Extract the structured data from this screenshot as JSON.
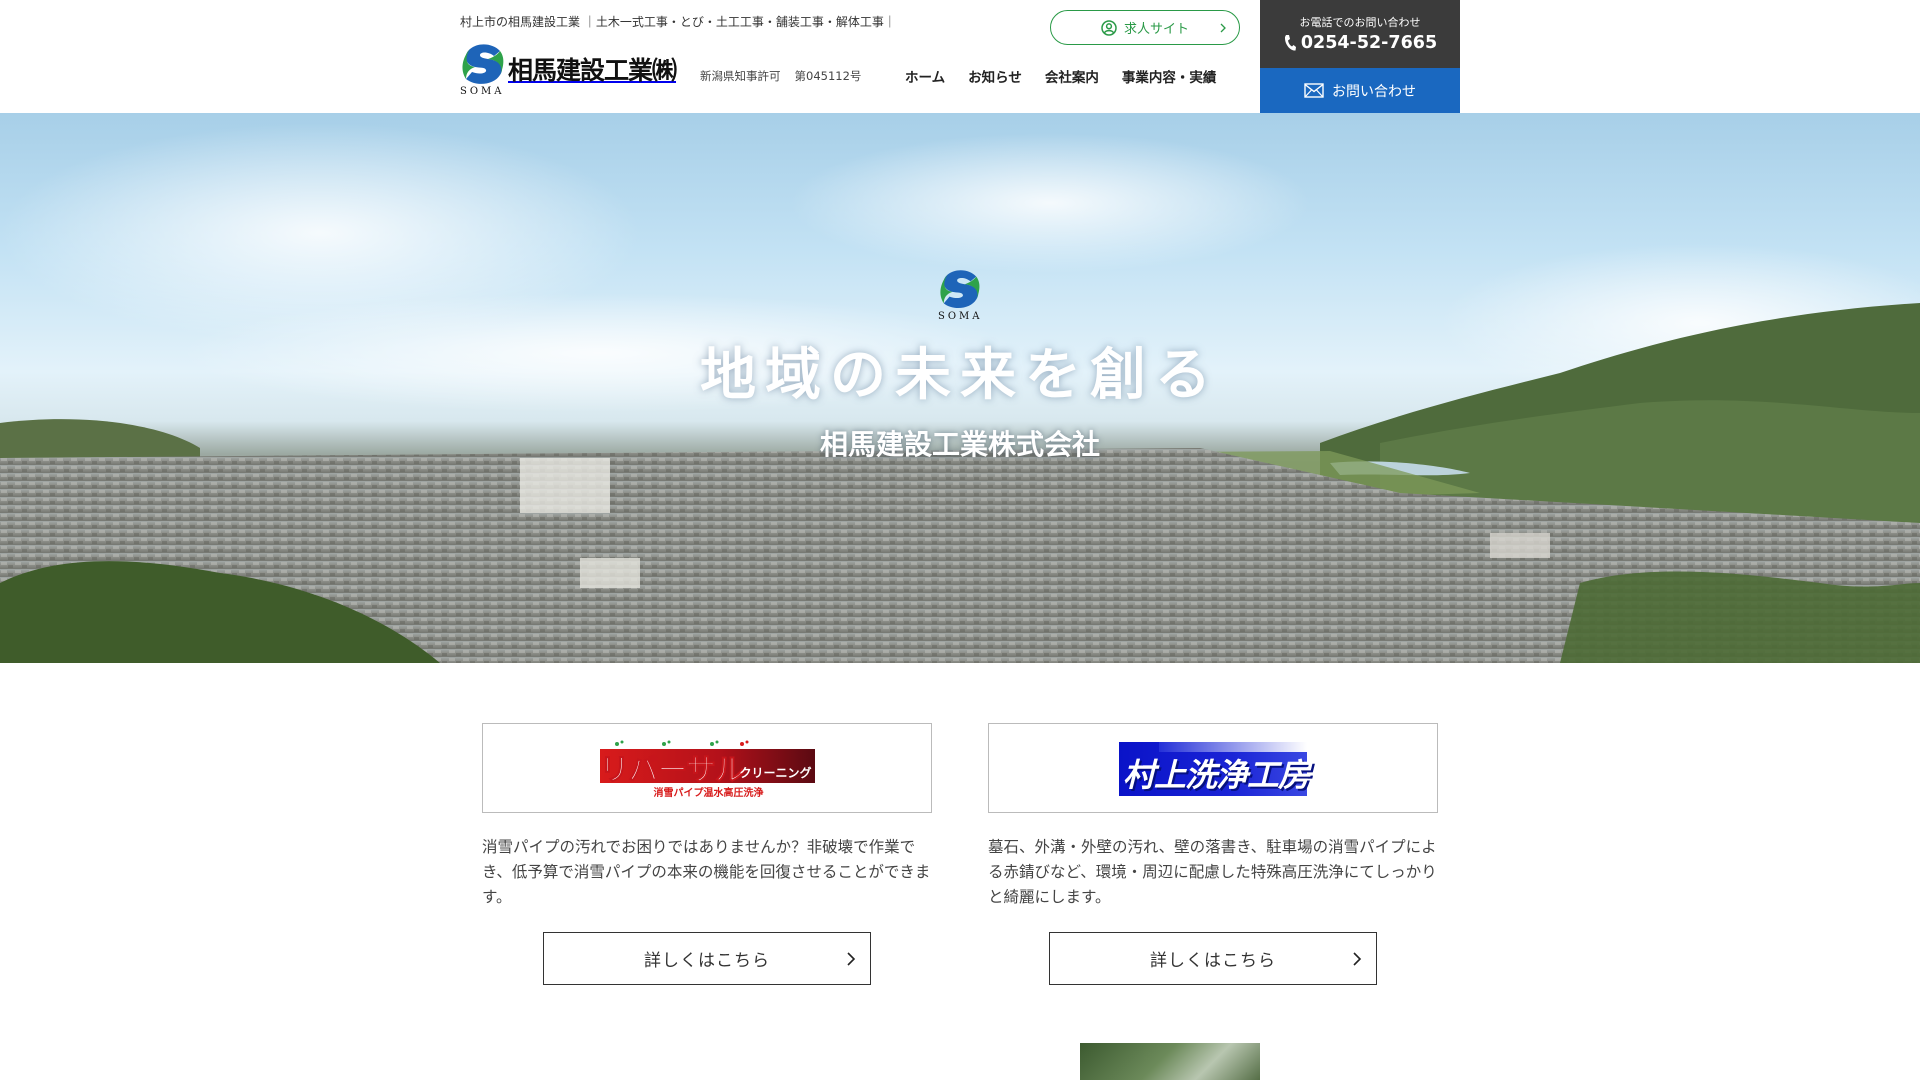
{
  "header": {
    "tagline": "村上市の相馬建設工業 ｜土木一式工事・とび・土工工事・舗装工事・解体工事｜",
    "logo": {
      "mark_text": "SOMA",
      "name": "相馬建設工業㈱"
    },
    "license": {
      "label": "新潟県知事許可",
      "number": "第045112号"
    },
    "recruit_label": "求人サイト",
    "nav": [
      "ホーム",
      "お知らせ",
      "会社案内",
      "事業内容・実績"
    ],
    "tel": {
      "label": "お電話でのお問い合わせ",
      "number": "0254-52-7665"
    },
    "contact_label": "お問い合わせ"
  },
  "hero": {
    "logo_text": "SOMA",
    "title": "地域の未来を創る",
    "subtitle": "相馬建設工業株式会社"
  },
  "services": [
    {
      "banner": {
        "main": "リバーサル",
        "sub": "クリーニング",
        "tagline": "消雪パイプ温水高圧洗浄"
      },
      "description": "消雪パイプの汚れでお困りではありませんか？非破壊で作業でき、低予算で消雪パイプの本来の機能を回復させることができます。",
      "button_label": "詳しくはこちら"
    },
    {
      "banner": {
        "main": "村上洗浄工房"
      },
      "description": "墓石、外溝・外壁の汚れ、壁の落書き、駐車場の消雪パイプによる赤錆びなど、環境・周辺に配慮した特殊高圧洗浄にてしっかりと綺麗にします。",
      "button_label": "詳しくはこちら"
    }
  ],
  "colors": {
    "brand_green": "#2a9a47",
    "brand_blue": "#1a68c0",
    "tel_bg": "#3b3b3b"
  },
  "icons": [
    "user-circle-icon",
    "chevron-right-icon",
    "phone-icon",
    "mail-icon",
    "soma-logo-icon"
  ]
}
